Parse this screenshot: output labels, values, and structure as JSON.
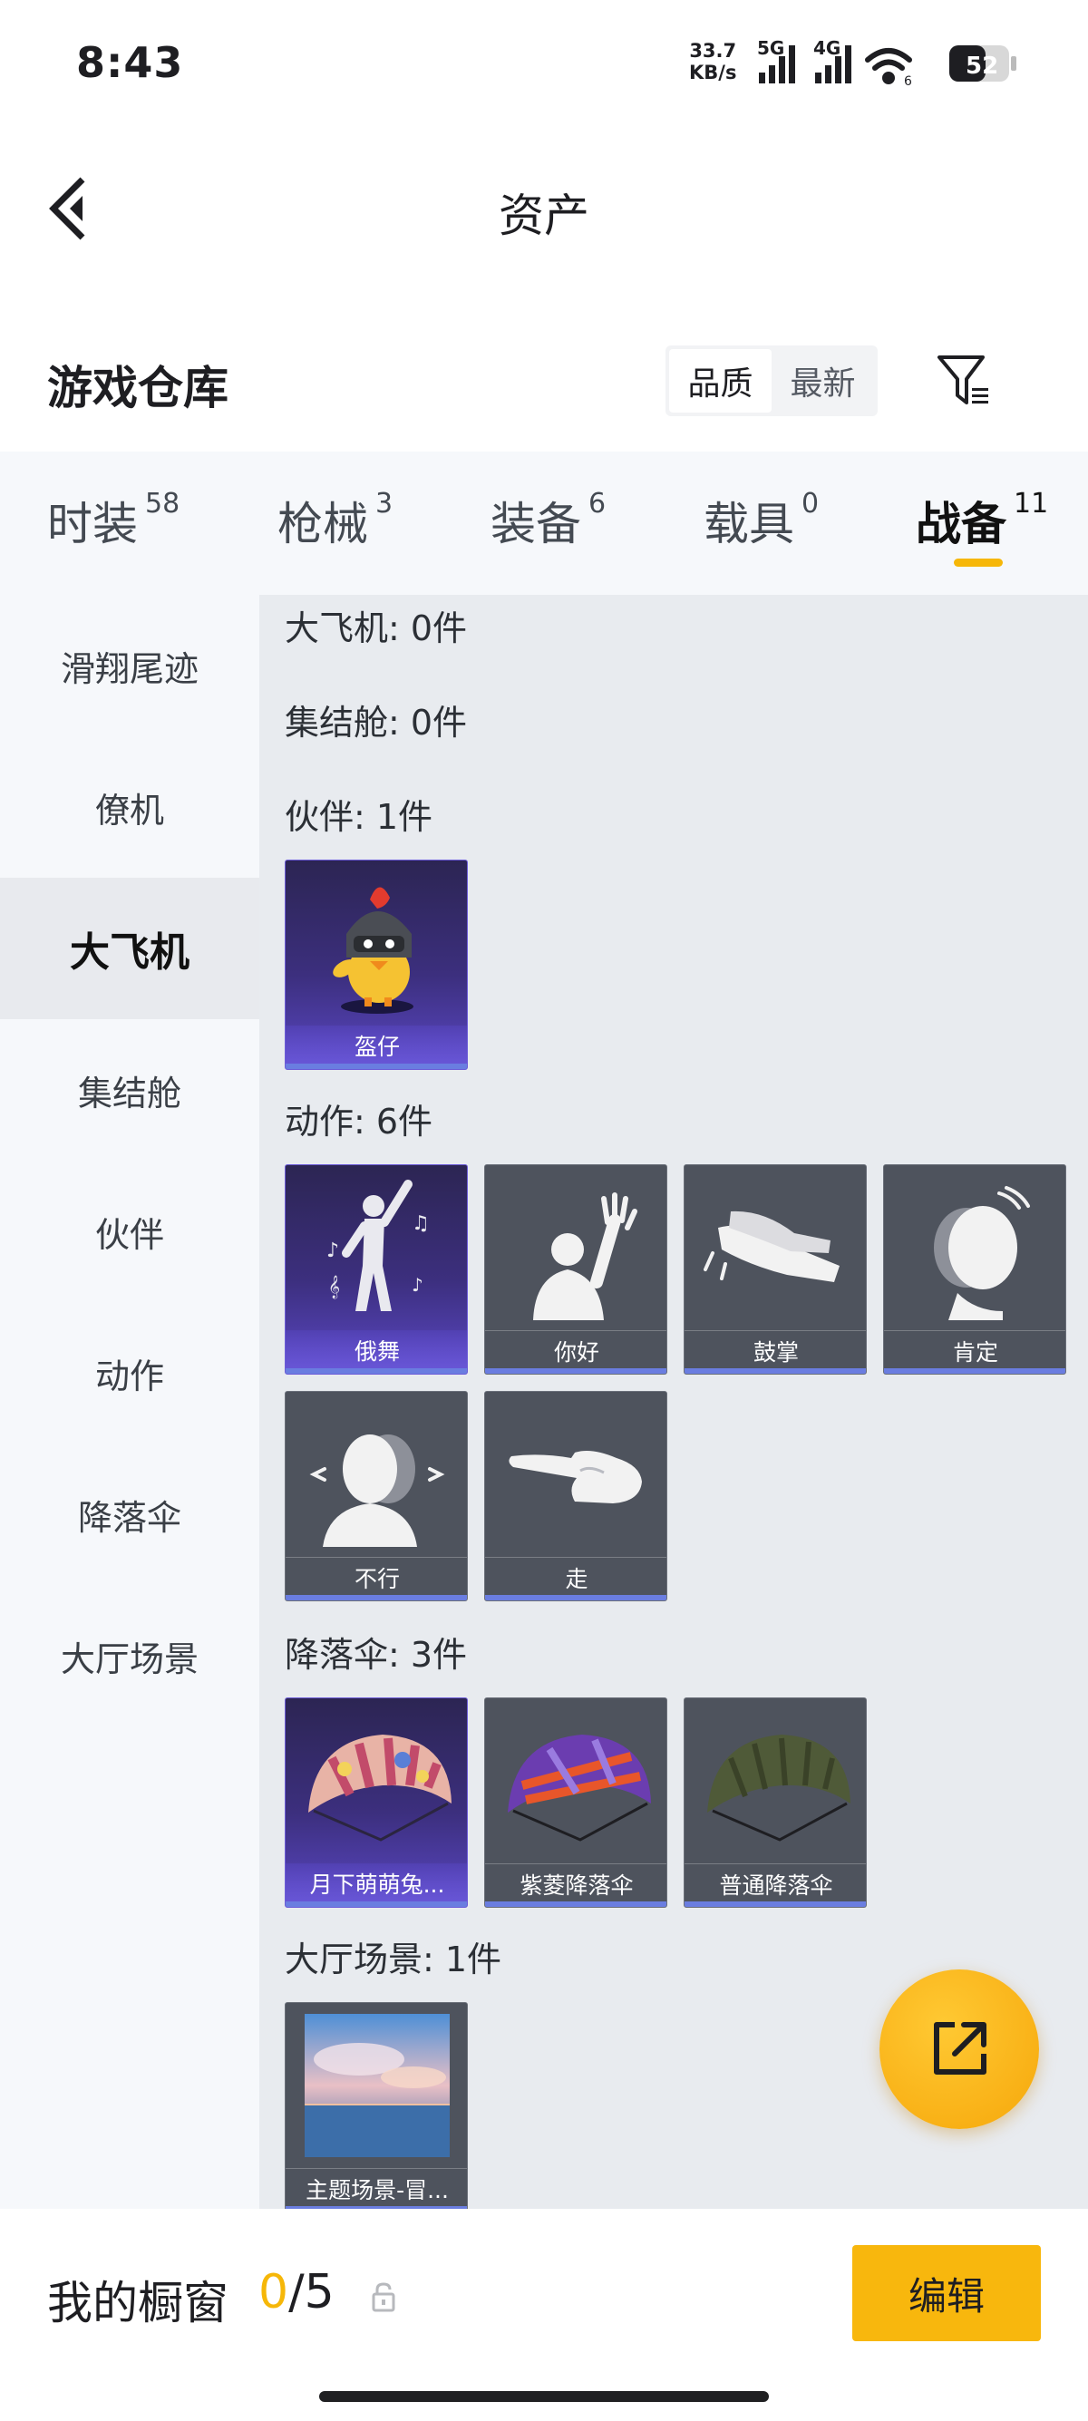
{
  "status_bar": {
    "time": "8:43",
    "speed_value": "33.7",
    "speed_unit": "KB/s",
    "network_1": "5G",
    "network_2": "4G",
    "wifi_badge": "6",
    "battery": "52"
  },
  "header": {
    "title": "资产",
    "back_icon": "chevron-left-icon"
  },
  "section": {
    "title": "游戏仓库",
    "sort_options": [
      "品质",
      "最新"
    ],
    "sort_active": "品质",
    "filter_icon": "filter-icon"
  },
  "category_tabs": [
    {
      "label": "时装",
      "count": "58"
    },
    {
      "label": "枪械",
      "count": "3"
    },
    {
      "label": "装备",
      "count": "6"
    },
    {
      "label": "载具",
      "count": "0"
    },
    {
      "label": "战备",
      "count": "11"
    }
  ],
  "category_active": "战备",
  "sidebar": {
    "items": [
      "滑翔尾迹",
      "僚机",
      "大飞机",
      "集结舱",
      "伙伴",
      "动作",
      "降落伞",
      "大厅场景"
    ],
    "active": "大飞机"
  },
  "groups": [
    {
      "label": "大飞机: 0件",
      "items": []
    },
    {
      "label": "集结舱: 0件",
      "items": []
    },
    {
      "label": "伙伴: 1件",
      "items": [
        {
          "name": "盔仔",
          "icon": "helmet-chick-icon",
          "rarity": "purple"
        }
      ]
    },
    {
      "label": "动作: 6件",
      "items": [
        {
          "name": "俄舞",
          "icon": "dance-icon",
          "rarity": "purple"
        },
        {
          "name": "你好",
          "icon": "wave-hello-icon",
          "rarity": "gray"
        },
        {
          "name": "鼓掌",
          "icon": "clap-icon",
          "rarity": "gray"
        },
        {
          "name": "肯定",
          "icon": "nod-icon",
          "rarity": "gray"
        },
        {
          "name": "不行",
          "icon": "head-shake-icon",
          "rarity": "gray"
        },
        {
          "name": "走",
          "icon": "point-icon",
          "rarity": "gray"
        }
      ]
    },
    {
      "label": "降落伞: 3件",
      "items": [
        {
          "name": "月下萌萌兔...",
          "icon": "parachute-icon",
          "rarity": "purple"
        },
        {
          "name": "紫菱降落伞",
          "icon": "parachute-icon",
          "rarity": "gray"
        },
        {
          "name": "普通降落伞",
          "icon": "parachute-icon",
          "rarity": "gray"
        }
      ]
    },
    {
      "label": "大厅场景: 1件",
      "items": [
        {
          "name": "主题场景-冒...",
          "icon": "scene-icon",
          "rarity": "gray"
        }
      ]
    }
  ],
  "fab_icon": "share-external-icon",
  "bottom_bar": {
    "label": "我的橱窗",
    "current": "0",
    "total": "/5",
    "lock_icon": "lock-icon",
    "edit_label": "编辑"
  },
  "colors": {
    "accent": "#f6b708",
    "purple_card": "#3c2f7e",
    "gray_card": "#4e535d",
    "card_bar": "#6a7de0"
  }
}
